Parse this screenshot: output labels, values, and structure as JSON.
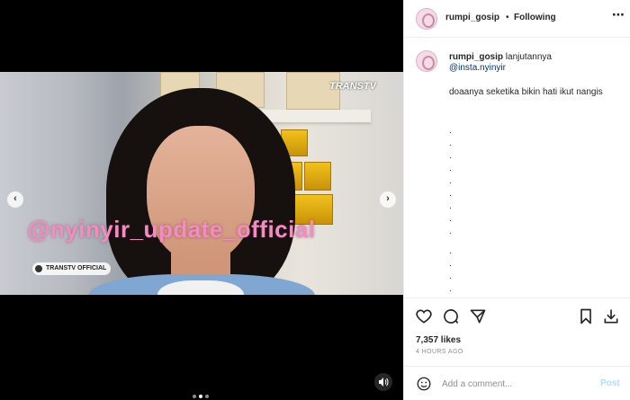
{
  "media": {
    "watermark": "@nyinyir_update_official",
    "channel_logo": "TRANSTV",
    "official_tag": "TRANSTV OFFICIAL",
    "prev_icon": "chevron-left",
    "next_icon": "chevron-right",
    "sound_icon": "speaker-icon",
    "carousel_dots": 3,
    "active_dot": 2
  },
  "header": {
    "username": "rumpi_gosip",
    "separator": "•",
    "follow_status": "Following",
    "more_label": "⋯"
  },
  "caption": {
    "username": "rumpi_gosip",
    "lead_text": "lanjutannya",
    "mention": "@insta.nyinyir",
    "body": "doaanya seketika bikin hati ikut nangis",
    "dots": [
      ".",
      ".",
      ".",
      ".",
      ".",
      ".",
      ".",
      ".",
      ".",
      ".",
      ".",
      ".",
      "."
    ]
  },
  "actions": {
    "like_icon": "heart-icon",
    "comment_icon": "comment-icon",
    "share_icon": "send-icon",
    "save_icon": "bookmark-icon",
    "download_icon": "download-icon"
  },
  "stats": {
    "likes": "7,357 likes",
    "time": "4 HOURS AGO"
  },
  "comment": {
    "placeholder": "Add a comment...",
    "post_label": "Post"
  },
  "colors": {
    "link": "#00376b",
    "post_disabled": "#b3dbff",
    "watermark": "#f08ec0"
  }
}
